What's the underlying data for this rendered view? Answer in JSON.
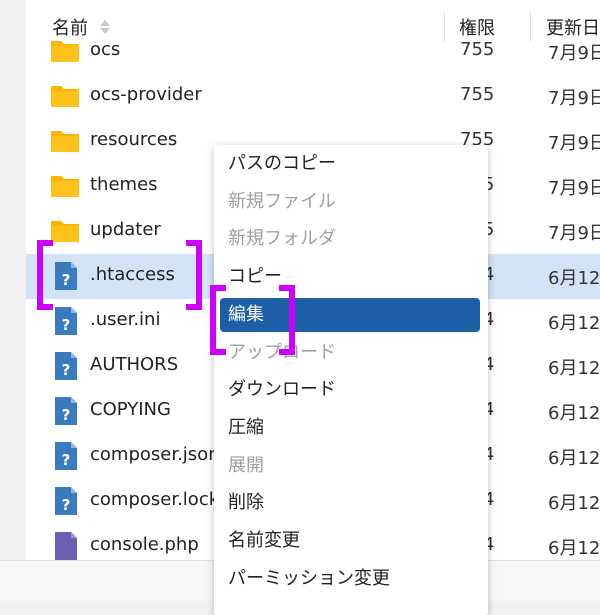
{
  "header": {
    "name_label": "名前",
    "permission_label": "権限",
    "modified_label": "更新日"
  },
  "rows": [
    {
      "name": "ocs",
      "perm": "755",
      "date": "7月9日",
      "icon": "folder-icon"
    },
    {
      "name": "ocs-provider",
      "perm": "755",
      "date": "7月9日",
      "icon": "folder-icon"
    },
    {
      "name": "resources",
      "perm": "755",
      "date": "7月9日",
      "icon": "folder-icon"
    },
    {
      "name": "themes",
      "perm": "755",
      "date": "7月9日",
      "icon": "folder-icon"
    },
    {
      "name": "updater",
      "perm": "755",
      "date": "7月9日",
      "icon": "folder-icon"
    },
    {
      "name": ".htaccess",
      "perm": "644",
      "date": "6月12",
      "icon": "unknown-file-icon"
    },
    {
      "name": ".user.ini",
      "perm": "644",
      "date": "6月12",
      "icon": "unknown-file-icon"
    },
    {
      "name": "AUTHORS",
      "perm": "644",
      "date": "6月12",
      "icon": "unknown-file-icon"
    },
    {
      "name": "COPYING",
      "perm": "644",
      "date": "6月12",
      "icon": "unknown-file-icon"
    },
    {
      "name": "composer.json",
      "perm": "644",
      "date": "6月12",
      "icon": "unknown-file-icon"
    },
    {
      "name": "composer.lock",
      "perm": "644",
      "date": "6月12",
      "icon": "unknown-file-icon"
    },
    {
      "name": "console.php",
      "perm": "644",
      "date": "6月12",
      "icon": "php-file-icon"
    }
  ],
  "context_menu": {
    "items": [
      {
        "label": "パスのコピー",
        "state": "enabled"
      },
      {
        "label": "新規ファイル",
        "state": "disabled"
      },
      {
        "label": "新規フォルダ",
        "state": "disabled"
      },
      {
        "label": "コピー",
        "state": "enabled"
      },
      {
        "label": "編集",
        "state": "active"
      },
      {
        "label": "アップロード",
        "state": "disabled"
      },
      {
        "label": "ダウンロード",
        "state": "enabled"
      },
      {
        "label": "圧縮",
        "state": "enabled"
      },
      {
        "label": "展開",
        "state": "disabled"
      },
      {
        "label": "削除",
        "state": "enabled"
      },
      {
        "label": "名前変更",
        "state": "enabled"
      },
      {
        "label": "パーミッション変更",
        "state": "enabled"
      }
    ]
  },
  "colors": {
    "folder": "#ffb400",
    "file": "#3a7bbf",
    "selection": "#d3e3f7",
    "active_menu": "#1c5fa7",
    "annotation": "#cc00ff"
  }
}
